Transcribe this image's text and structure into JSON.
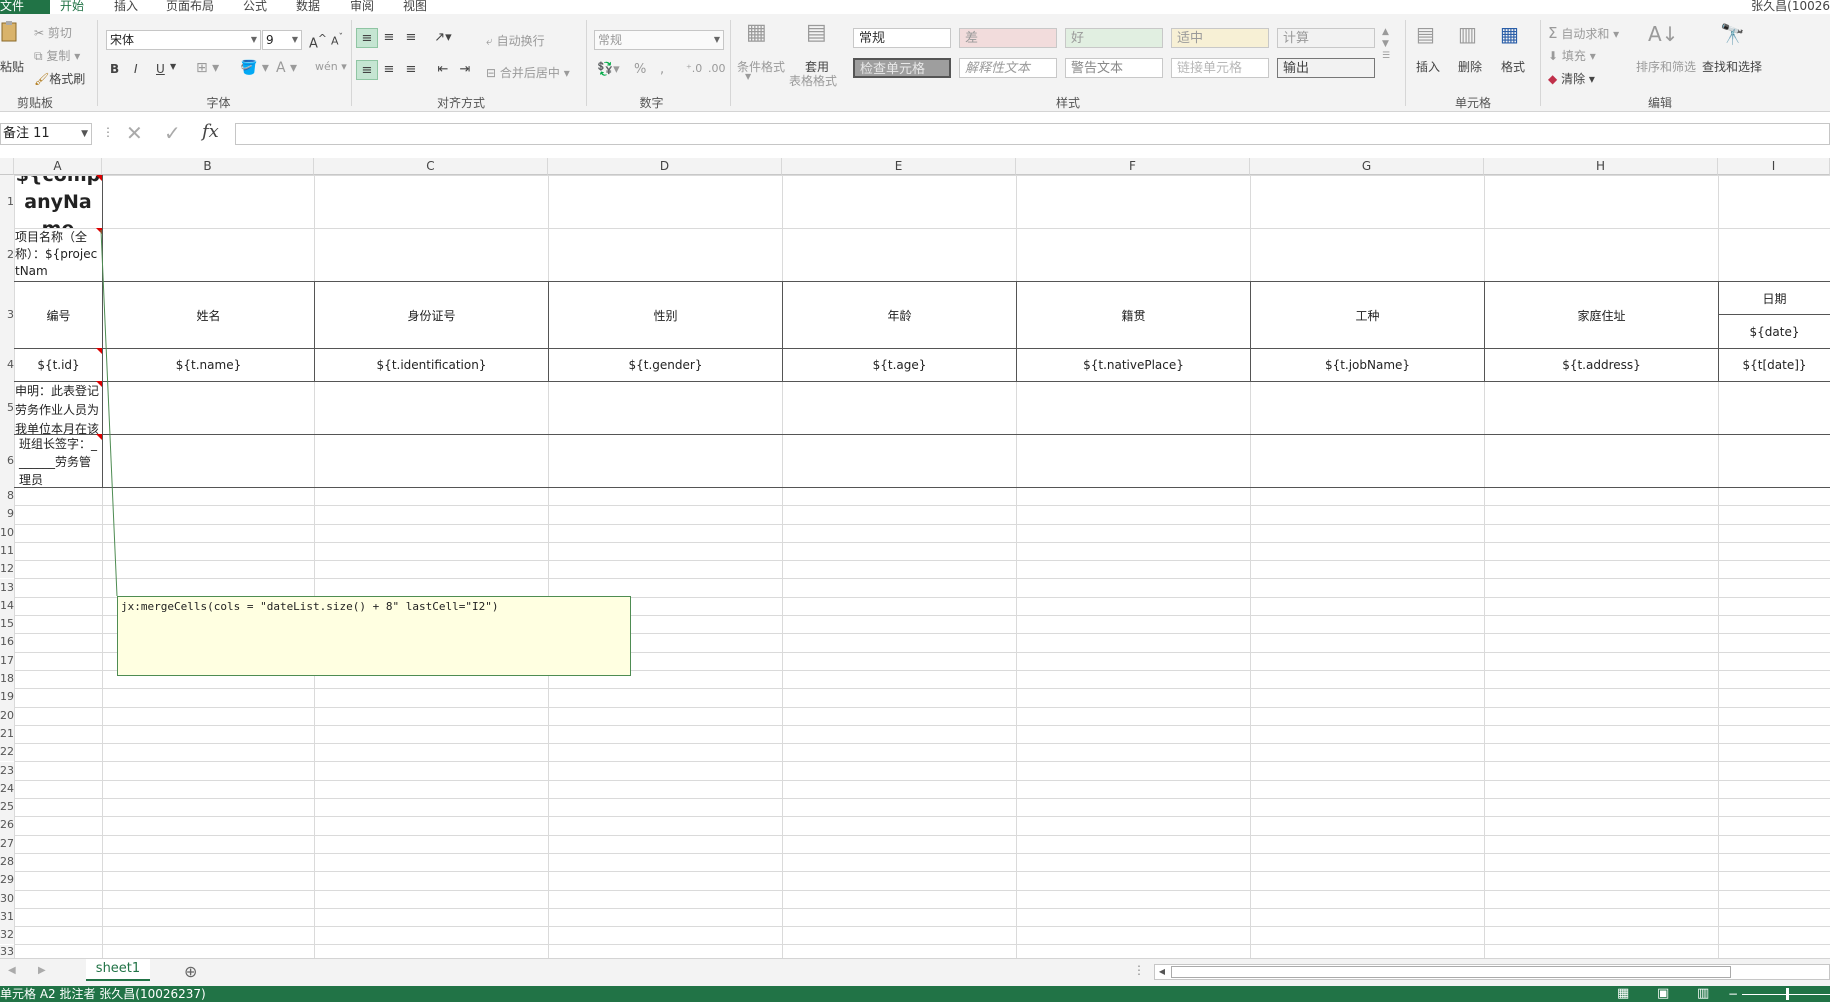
{
  "tabs": [
    "文件",
    "开始",
    "插入",
    "页面布局",
    "公式",
    "数据",
    "审阅",
    "视图"
  ],
  "user": "张久昌(10026",
  "clipboard": {
    "paste": "粘贴",
    "cut": "剪切",
    "copy": "复制",
    "format_painter": "格式刷",
    "label": "剪贴板"
  },
  "font": {
    "name": "宋体",
    "size": "9",
    "bold": "B",
    "italic": "I",
    "underline": "U",
    "label": "字体"
  },
  "alignment": {
    "wrap": "自动换行",
    "merge": "合并后居中",
    "label": "对齐方式"
  },
  "number": {
    "format": "常规",
    "percent": "%",
    "comma": ",",
    "label": "数字"
  },
  "styles": {
    "conditional": "条件格式",
    "table_format_1": "套用",
    "table_format_2": "表格格式",
    "cells": [
      "常规",
      "差",
      "好",
      "适中",
      "计算",
      "检查单元格",
      "解释性文本",
      "警告文本",
      "链接单元格",
      "输出"
    ],
    "label": "样式"
  },
  "cells_group": {
    "insert": "插入",
    "delete": "删除",
    "format": "格式",
    "label": "单元格"
  },
  "editing": {
    "autosum": "自动求和",
    "fill": "填充",
    "clear": "清除",
    "sort": "排序和筛选",
    "find": "查找和选择",
    "label": "编辑"
  },
  "formula_bar": {
    "name_box": "备注 11",
    "fx": "fx"
  },
  "columns": [
    "A",
    "B",
    "C",
    "D",
    "E",
    "F",
    "G",
    "H",
    "I"
  ],
  "rows": [
    "1",
    "2",
    "3",
    "4",
    "5",
    "6",
    "7",
    "8",
    "9",
    "10",
    "11",
    "12",
    "13",
    "14",
    "15",
    "16",
    "17",
    "18",
    "19",
    "20",
    "21",
    "22",
    "23",
    "24",
    "25",
    "26",
    "27",
    "28",
    "29",
    "30",
    "31",
    "32",
    "33"
  ],
  "sheet": {
    "a1": "${companyName",
    "a2": "项目名称（全称）：${projectNam",
    "headers": [
      "编号",
      "姓名",
      "身份证号",
      "性别",
      "年龄",
      "籍贯",
      "工种",
      "家庭住址",
      "日期"
    ],
    "date_sub": "${date}",
    "templates": [
      "${t.id}",
      "${t.name}",
      "${t.identification}",
      "${t.gender}",
      "${t.age}",
      "${t.nativePlace}",
      "${t.jobName}",
      "${t.address}",
      "${t[date]}"
    ],
    "a5": "申明：此表登记劳务作业人员为我单位本月在该",
    "a6": "班组长签字：_______劳务管理员"
  },
  "comment": "jx:mergeCells(cols = \"dateList.size() + 8\" lastCell=\"I2\")",
  "sheet_tab": "sheet1",
  "status": "单元格 A2 批注者 张久昌(10026237)"
}
